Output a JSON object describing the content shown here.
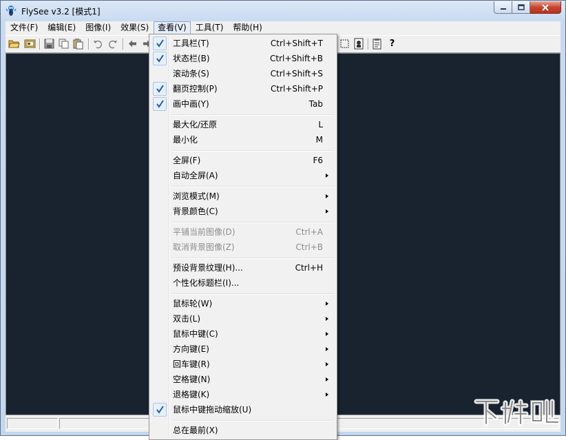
{
  "window": {
    "title": "FlySee v3.2 [模式1]"
  },
  "menubar": {
    "items": [
      {
        "label": "文件(F)"
      },
      {
        "label": "编辑(E)"
      },
      {
        "label": "图像(I)"
      },
      {
        "label": "效果(S)"
      },
      {
        "label": "查看(V)"
      },
      {
        "label": "工具(T)"
      },
      {
        "label": "帮助(H)"
      }
    ],
    "active_index": 4
  },
  "toolbar": {
    "icons": [
      "open-folder-icon",
      "open-image-icon",
      "save-icon",
      "copy-icon",
      "paste-icon",
      "undo-icon",
      "redo-icon",
      "back-arrow-icon",
      "forward-arrow-icon",
      "crop-icon",
      "view-icon",
      "properties-icon",
      "help-icon"
    ],
    "help_label": "?"
  },
  "view_menu": {
    "items": [
      {
        "label": "工具栏(T)",
        "shortcut": "Ctrl+Shift+T",
        "checked": true
      },
      {
        "label": "状态栏(B)",
        "shortcut": "Ctrl+Shift+B",
        "checked": true
      },
      {
        "label": "滚动条(S)",
        "shortcut": "Ctrl+Shift+S",
        "checked": false
      },
      {
        "label": "翻页控制(P)",
        "shortcut": "Ctrl+Shift+P",
        "checked": true
      },
      {
        "label": "画中画(Y)",
        "shortcut": "Tab",
        "checked": true
      },
      {
        "label": "最大化/还原",
        "shortcut": "L"
      },
      {
        "label": "最小化",
        "shortcut": "M"
      },
      {
        "label": "全屏(F)",
        "shortcut": "F6"
      },
      {
        "label": "自动全屏(A)",
        "submenu": true
      },
      {
        "label": "浏览模式(M)",
        "submenu": true
      },
      {
        "label": "背景颜色(C)",
        "submenu": true
      },
      {
        "label": "平铺当前图像(D)",
        "shortcut": "Ctrl+A",
        "disabled": true
      },
      {
        "label": "取消背景图像(Z)",
        "shortcut": "Ctrl+B",
        "disabled": true
      },
      {
        "label": "预设背景纹理(H)...",
        "shortcut": "Ctrl+H"
      },
      {
        "label": "个性化标题栏(I)..."
      },
      {
        "label": "鼠标轮(W)",
        "submenu": true
      },
      {
        "label": "双击(L)",
        "submenu": true
      },
      {
        "label": "鼠标中键(C)",
        "submenu": true
      },
      {
        "label": "方向键(E)",
        "submenu": true
      },
      {
        "label": "回车键(R)",
        "submenu": true
      },
      {
        "label": "空格键(N)",
        "submenu": true
      },
      {
        "label": "退格键(K)",
        "submenu": true
      },
      {
        "label": "鼠标中键拖动缩放(U)",
        "checked": true
      },
      {
        "label": "总在最前(X)"
      }
    ]
  },
  "colors": {
    "canvas_bg": "#18232f",
    "check_color": "#1c5fb8"
  },
  "watermark_icon": "xiazaiba-logo-icon"
}
